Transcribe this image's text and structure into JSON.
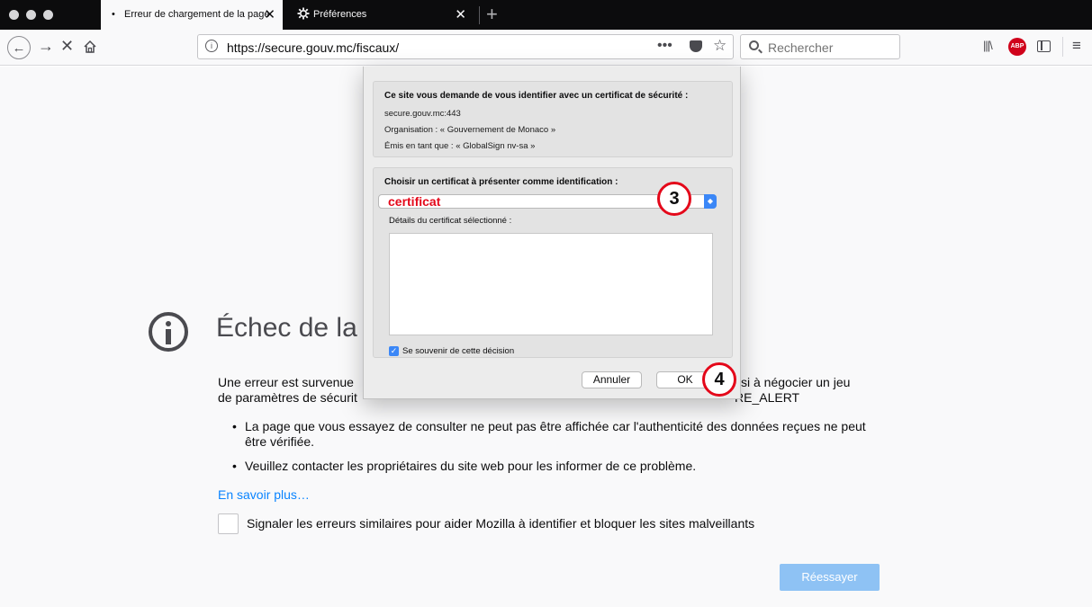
{
  "tabs": [
    {
      "label": "Erreur de chargement de la page",
      "close": "✕",
      "active": true
    },
    {
      "label": "Préférences",
      "close": "✕",
      "active": false
    }
  ],
  "new_tab_glyph": "+",
  "nav": {
    "url": "https://secure.gouv.mc/fiscaux/",
    "page_actions_glyph": "•••",
    "search_placeholder": "Rechercher",
    "abp_label": "ABP",
    "icons": [
      "back-icon",
      "forward-icon",
      "stop-icon",
      "home-icon",
      "info-icon",
      "pocket-icon",
      "star-icon",
      "library-icon",
      "adblock-icon",
      "sidebar-icon",
      "menu-icon"
    ]
  },
  "error_page": {
    "title": "Échec de la",
    "para_left_1": "Une erreur est survenue",
    "para_right_1": "ssi à négocier un jeu",
    "para_left_2": "de paramètres de sécurit",
    "para_right_2": "RE_ALERT",
    "bullets": [
      "La page que vous essayez de consulter ne peut pas être affichée car l'authenticité des données reçues ne peut être vérifiée.",
      "Veuillez contacter les propriétaires du site web pour les informer de ce problème."
    ],
    "learn_more": "En savoir plus…",
    "report_label": "Signaler les erreurs similaires pour aider Mozilla à identifier et bloquer les sites malveillants",
    "retry_label": "Réessayer"
  },
  "dialog": {
    "request_heading": "Ce site vous demande de vous identifier avec un certificat de sécurité :",
    "host": "secure.gouv.mc:443",
    "organisation": "Organisation : « Gouvernement de Monaco »",
    "issued_by": "Émis en tant que : « GlobalSign nv-sa »",
    "choose_heading": "Choisir un certificat à présenter comme identification :",
    "selected_certificate": "certificat",
    "details_label": "Détails du certificat sélectionné :",
    "remember_label": "Se souvenir de cette décision",
    "remember_checked": true,
    "cancel_label": "Annuler",
    "ok_label": "OK"
  },
  "markers": {
    "step3": "3",
    "step4": "4",
    "color": "#e4081a"
  },
  "colors": {
    "accent": "#0a84ff",
    "select_accent": "#3b87f7",
    "retry_bg": "#8ec2f4"
  }
}
